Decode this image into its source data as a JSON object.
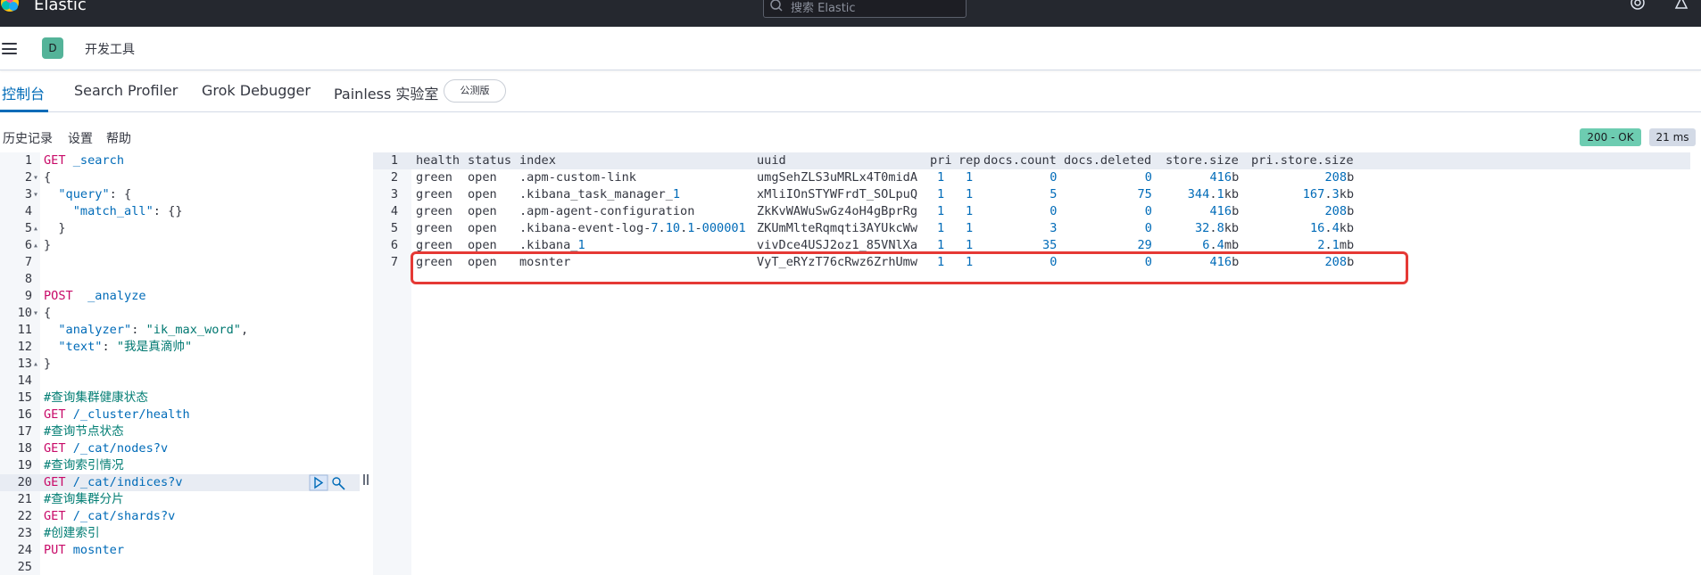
{
  "header": {
    "brand": "Elastic",
    "search_placeholder": "搜索 Elastic"
  },
  "breadcrumb": {
    "avatar_letter": "D",
    "app_name": "开发工具"
  },
  "tabs": [
    {
      "label": "控制台",
      "active": true
    },
    {
      "label": "Search Profiler",
      "active": false
    },
    {
      "label": "Grok Debugger",
      "active": false
    },
    {
      "label": "Painless 实验室",
      "active": false,
      "badge": "公测版"
    }
  ],
  "actions": {
    "history": "历史记录",
    "settings": "设置",
    "help": "帮助"
  },
  "status": {
    "code": "200 - OK",
    "time": "21 ms",
    "ok_color": "#6dccb1"
  },
  "editor": {
    "active_line": 20,
    "lines": [
      {
        "n": "1",
        "fold": "",
        "parts": [
          {
            "t": "GET",
            "c": "kw"
          },
          {
            "t": " _search",
            "c": "url"
          }
        ]
      },
      {
        "n": "2",
        "fold": "▾",
        "parts": [
          {
            "t": "{",
            "c": "punc"
          }
        ]
      },
      {
        "n": "3",
        "fold": "▾",
        "parts": [
          {
            "t": "  ",
            "c": "punc"
          },
          {
            "t": "\"query\"",
            "c": "key"
          },
          {
            "t": ": {",
            "c": "punc"
          }
        ]
      },
      {
        "n": "4",
        "fold": "",
        "parts": [
          {
            "t": "    ",
            "c": "punc"
          },
          {
            "t": "\"match_all\"",
            "c": "key"
          },
          {
            "t": ": {}",
            "c": "punc"
          }
        ]
      },
      {
        "n": "5",
        "fold": "▴",
        "parts": [
          {
            "t": "  }",
            "c": "punc"
          }
        ]
      },
      {
        "n": "6",
        "fold": "▴",
        "parts": [
          {
            "t": "}",
            "c": "punc"
          }
        ]
      },
      {
        "n": "7",
        "fold": "",
        "parts": []
      },
      {
        "n": "8",
        "fold": "",
        "parts": []
      },
      {
        "n": "9",
        "fold": "",
        "parts": [
          {
            "t": "POST",
            "c": "kw"
          },
          {
            "t": "  _analyze",
            "c": "url"
          }
        ]
      },
      {
        "n": "10",
        "fold": "▾",
        "parts": [
          {
            "t": "{",
            "c": "punc"
          }
        ]
      },
      {
        "n": "11",
        "fold": "",
        "parts": [
          {
            "t": "  ",
            "c": "punc"
          },
          {
            "t": "\"analyzer\"",
            "c": "key"
          },
          {
            "t": ": ",
            "c": "punc"
          },
          {
            "t": "\"ik_max_word\"",
            "c": "str"
          },
          {
            "t": ",",
            "c": "punc"
          }
        ]
      },
      {
        "n": "12",
        "fold": "",
        "parts": [
          {
            "t": "  ",
            "c": "punc"
          },
          {
            "t": "\"text\"",
            "c": "key"
          },
          {
            "t": ": ",
            "c": "punc"
          },
          {
            "t": "\"我是真滴帅\"",
            "c": "str"
          }
        ]
      },
      {
        "n": "13",
        "fold": "▴",
        "parts": [
          {
            "t": "}",
            "c": "punc"
          }
        ]
      },
      {
        "n": "14",
        "fold": "",
        "parts": []
      },
      {
        "n": "15",
        "fold": "",
        "parts": [
          {
            "t": "#查询集群健康状态",
            "c": "cmt"
          }
        ]
      },
      {
        "n": "16",
        "fold": "",
        "parts": [
          {
            "t": "GET",
            "c": "kw"
          },
          {
            "t": " /_cluster/health",
            "c": "url"
          }
        ]
      },
      {
        "n": "17",
        "fold": "",
        "parts": [
          {
            "t": "#查询节点状态",
            "c": "cmt"
          }
        ]
      },
      {
        "n": "18",
        "fold": "",
        "parts": [
          {
            "t": "GET",
            "c": "kw"
          },
          {
            "t": " /_cat/nodes?v",
            "c": "url"
          }
        ]
      },
      {
        "n": "19",
        "fold": "",
        "parts": [
          {
            "t": "#查询索引情况",
            "c": "cmt"
          }
        ]
      },
      {
        "n": "20",
        "fold": "",
        "parts": [
          {
            "t": "GET",
            "c": "kw"
          },
          {
            "t": " /_cat/indices?v",
            "c": "url"
          }
        ]
      },
      {
        "n": "21",
        "fold": "",
        "parts": [
          {
            "t": "#查询集群分片",
            "c": "cmt"
          }
        ]
      },
      {
        "n": "22",
        "fold": "",
        "parts": [
          {
            "t": "GET",
            "c": "kw"
          },
          {
            "t": " /_cat/shards?v",
            "c": "url"
          }
        ]
      },
      {
        "n": "23",
        "fold": "",
        "parts": [
          {
            "t": "#创建索引",
            "c": "cmt"
          }
        ]
      },
      {
        "n": "24",
        "fold": "",
        "parts": [
          {
            "t": "PUT",
            "c": "kw"
          },
          {
            "t": " mosnter",
            "c": "url"
          }
        ]
      },
      {
        "n": "25",
        "fold": "",
        "parts": []
      }
    ]
  },
  "output": {
    "columns": [
      "health",
      "status",
      "index",
      "uuid",
      "pri",
      "rep",
      "docs.count",
      "docs.deleted",
      "store.size",
      "pri.store.size"
    ],
    "rows": [
      [
        "green",
        "open",
        ".apm-custom-link",
        "umgSehZLS3uMRLx4T0midA",
        "1",
        "1",
        "0",
        "0",
        "416b",
        "208b"
      ],
      [
        "green",
        "open",
        ".kibana_task_manager_1",
        "xMliIOnSTYWFrdT_SOLpuQ",
        "1",
        "1",
        "5",
        "75",
        "344.1kb",
        "167.3kb"
      ],
      [
        "green",
        "open",
        ".apm-agent-configuration",
        "ZkKvWAWuSwGz4oH4gBprRg",
        "1",
        "1",
        "0",
        "0",
        "416b",
        "208b"
      ],
      [
        "green",
        "open",
        ".kibana-event-log-7.10.1-000001",
        "ZKUmMlteRqmqti3AYUkcWw",
        "1",
        "1",
        "3",
        "0",
        "32.8kb",
        "16.4kb"
      ],
      [
        "green",
        "open",
        ".kibana_1",
        "vivDce4USJ2oz1_85VNlXa",
        "1",
        "1",
        "35",
        "29",
        "6.4mb",
        "2.1mb"
      ],
      [
        "green",
        "open",
        "mosnter",
        "VyT_eRYzT76cRwz6ZrhUmw",
        "1",
        "1",
        "0",
        "0",
        "416b",
        "208b"
      ]
    ],
    "highlighted_row": 6,
    "highlight_color": "#e53935"
  }
}
